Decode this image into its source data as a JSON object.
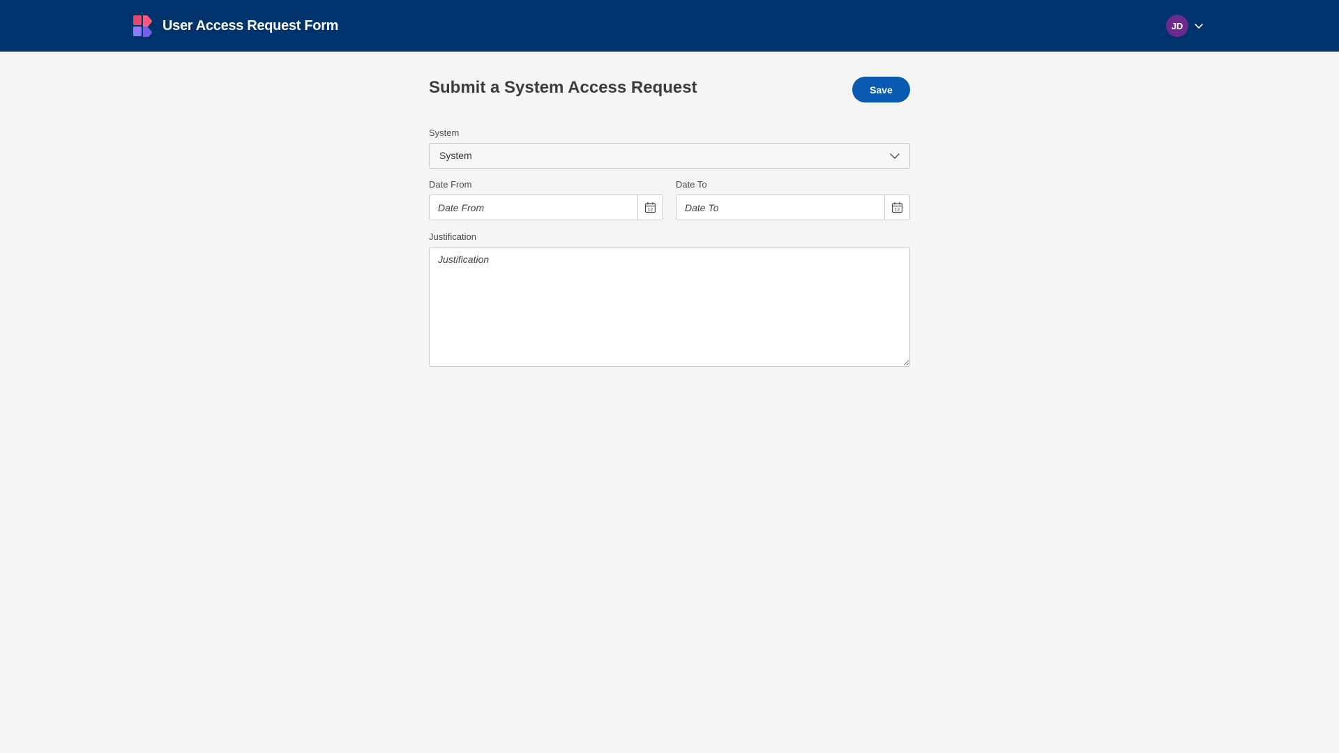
{
  "header": {
    "app_title": "User Access Request Form",
    "logo_icon": "app-logo-icon",
    "user_initials": "JD",
    "user_menu_icon": "chevron-down-icon"
  },
  "colors": {
    "header_bg": "#00336b",
    "primary": "#0a5ab4",
    "avatar_bg": "#6b2a8c",
    "page_bg": "#f5f5f5"
  },
  "form": {
    "title": "Submit a System Access Request",
    "save_label": "Save",
    "system": {
      "label": "System",
      "value": "System",
      "icon": "chevron-down-icon"
    },
    "date_from": {
      "label": "Date From",
      "placeholder": "Date From",
      "icon": "calendar-icon"
    },
    "date_to": {
      "label": "Date To",
      "placeholder": "Date To",
      "icon": "calendar-icon"
    },
    "justification": {
      "label": "Justification",
      "placeholder": "Justification"
    }
  }
}
